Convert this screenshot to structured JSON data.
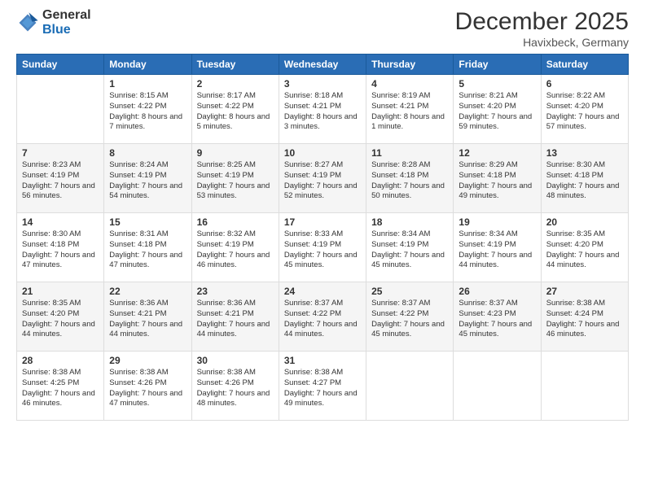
{
  "header": {
    "logo_general": "General",
    "logo_blue": "Blue",
    "title": "December 2025",
    "location": "Havixbeck, Germany"
  },
  "weekdays": [
    "Sunday",
    "Monday",
    "Tuesday",
    "Wednesday",
    "Thursday",
    "Friday",
    "Saturday"
  ],
  "weeks": [
    [
      {
        "day": "",
        "sunrise": "",
        "sunset": "",
        "daylight": ""
      },
      {
        "day": "1",
        "sunrise": "Sunrise: 8:15 AM",
        "sunset": "Sunset: 4:22 PM",
        "daylight": "Daylight: 8 hours and 7 minutes."
      },
      {
        "day": "2",
        "sunrise": "Sunrise: 8:17 AM",
        "sunset": "Sunset: 4:22 PM",
        "daylight": "Daylight: 8 hours and 5 minutes."
      },
      {
        "day": "3",
        "sunrise": "Sunrise: 8:18 AM",
        "sunset": "Sunset: 4:21 PM",
        "daylight": "Daylight: 8 hours and 3 minutes."
      },
      {
        "day": "4",
        "sunrise": "Sunrise: 8:19 AM",
        "sunset": "Sunset: 4:21 PM",
        "daylight": "Daylight: 8 hours and 1 minute."
      },
      {
        "day": "5",
        "sunrise": "Sunrise: 8:21 AM",
        "sunset": "Sunset: 4:20 PM",
        "daylight": "Daylight: 7 hours and 59 minutes."
      },
      {
        "day": "6",
        "sunrise": "Sunrise: 8:22 AM",
        "sunset": "Sunset: 4:20 PM",
        "daylight": "Daylight: 7 hours and 57 minutes."
      }
    ],
    [
      {
        "day": "7",
        "sunrise": "Sunrise: 8:23 AM",
        "sunset": "Sunset: 4:19 PM",
        "daylight": "Daylight: 7 hours and 56 minutes."
      },
      {
        "day": "8",
        "sunrise": "Sunrise: 8:24 AM",
        "sunset": "Sunset: 4:19 PM",
        "daylight": "Daylight: 7 hours and 54 minutes."
      },
      {
        "day": "9",
        "sunrise": "Sunrise: 8:25 AM",
        "sunset": "Sunset: 4:19 PM",
        "daylight": "Daylight: 7 hours and 53 minutes."
      },
      {
        "day": "10",
        "sunrise": "Sunrise: 8:27 AM",
        "sunset": "Sunset: 4:19 PM",
        "daylight": "Daylight: 7 hours and 52 minutes."
      },
      {
        "day": "11",
        "sunrise": "Sunrise: 8:28 AM",
        "sunset": "Sunset: 4:18 PM",
        "daylight": "Daylight: 7 hours and 50 minutes."
      },
      {
        "day": "12",
        "sunrise": "Sunrise: 8:29 AM",
        "sunset": "Sunset: 4:18 PM",
        "daylight": "Daylight: 7 hours and 49 minutes."
      },
      {
        "day": "13",
        "sunrise": "Sunrise: 8:30 AM",
        "sunset": "Sunset: 4:18 PM",
        "daylight": "Daylight: 7 hours and 48 minutes."
      }
    ],
    [
      {
        "day": "14",
        "sunrise": "Sunrise: 8:30 AM",
        "sunset": "Sunset: 4:18 PM",
        "daylight": "Daylight: 7 hours and 47 minutes."
      },
      {
        "day": "15",
        "sunrise": "Sunrise: 8:31 AM",
        "sunset": "Sunset: 4:18 PM",
        "daylight": "Daylight: 7 hours and 47 minutes."
      },
      {
        "day": "16",
        "sunrise": "Sunrise: 8:32 AM",
        "sunset": "Sunset: 4:19 PM",
        "daylight": "Daylight: 7 hours and 46 minutes."
      },
      {
        "day": "17",
        "sunrise": "Sunrise: 8:33 AM",
        "sunset": "Sunset: 4:19 PM",
        "daylight": "Daylight: 7 hours and 45 minutes."
      },
      {
        "day": "18",
        "sunrise": "Sunrise: 8:34 AM",
        "sunset": "Sunset: 4:19 PM",
        "daylight": "Daylight: 7 hours and 45 minutes."
      },
      {
        "day": "19",
        "sunrise": "Sunrise: 8:34 AM",
        "sunset": "Sunset: 4:19 PM",
        "daylight": "Daylight: 7 hours and 44 minutes."
      },
      {
        "day": "20",
        "sunrise": "Sunrise: 8:35 AM",
        "sunset": "Sunset: 4:20 PM",
        "daylight": "Daylight: 7 hours and 44 minutes."
      }
    ],
    [
      {
        "day": "21",
        "sunrise": "Sunrise: 8:35 AM",
        "sunset": "Sunset: 4:20 PM",
        "daylight": "Daylight: 7 hours and 44 minutes."
      },
      {
        "day": "22",
        "sunrise": "Sunrise: 8:36 AM",
        "sunset": "Sunset: 4:21 PM",
        "daylight": "Daylight: 7 hours and 44 minutes."
      },
      {
        "day": "23",
        "sunrise": "Sunrise: 8:36 AM",
        "sunset": "Sunset: 4:21 PM",
        "daylight": "Daylight: 7 hours and 44 minutes."
      },
      {
        "day": "24",
        "sunrise": "Sunrise: 8:37 AM",
        "sunset": "Sunset: 4:22 PM",
        "daylight": "Daylight: 7 hours and 44 minutes."
      },
      {
        "day": "25",
        "sunrise": "Sunrise: 8:37 AM",
        "sunset": "Sunset: 4:22 PM",
        "daylight": "Daylight: 7 hours and 45 minutes."
      },
      {
        "day": "26",
        "sunrise": "Sunrise: 8:37 AM",
        "sunset": "Sunset: 4:23 PM",
        "daylight": "Daylight: 7 hours and 45 minutes."
      },
      {
        "day": "27",
        "sunrise": "Sunrise: 8:38 AM",
        "sunset": "Sunset: 4:24 PM",
        "daylight": "Daylight: 7 hours and 46 minutes."
      }
    ],
    [
      {
        "day": "28",
        "sunrise": "Sunrise: 8:38 AM",
        "sunset": "Sunset: 4:25 PM",
        "daylight": "Daylight: 7 hours and 46 minutes."
      },
      {
        "day": "29",
        "sunrise": "Sunrise: 8:38 AM",
        "sunset": "Sunset: 4:26 PM",
        "daylight": "Daylight: 7 hours and 47 minutes."
      },
      {
        "day": "30",
        "sunrise": "Sunrise: 8:38 AM",
        "sunset": "Sunset: 4:26 PM",
        "daylight": "Daylight: 7 hours and 48 minutes."
      },
      {
        "day": "31",
        "sunrise": "Sunrise: 8:38 AM",
        "sunset": "Sunset: 4:27 PM",
        "daylight": "Daylight: 7 hours and 49 minutes."
      },
      {
        "day": "",
        "sunrise": "",
        "sunset": "",
        "daylight": ""
      },
      {
        "day": "",
        "sunrise": "",
        "sunset": "",
        "daylight": ""
      },
      {
        "day": "",
        "sunrise": "",
        "sunset": "",
        "daylight": ""
      }
    ]
  ]
}
